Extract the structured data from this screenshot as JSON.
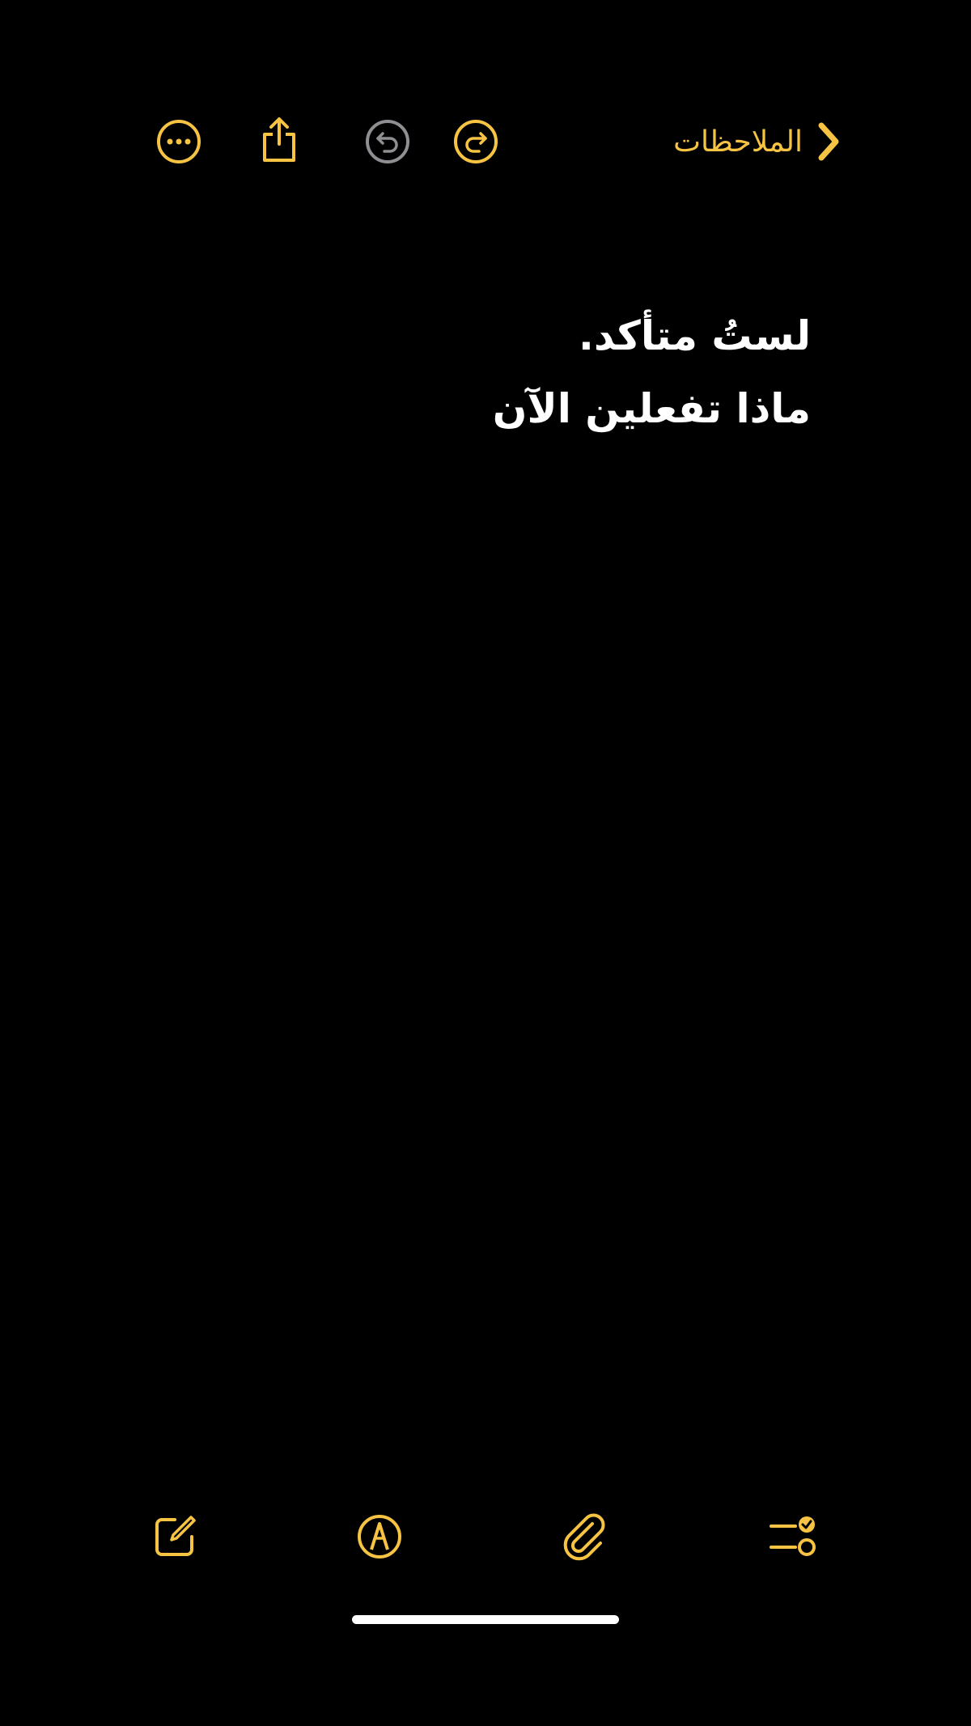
{
  "nav": {
    "back_label": "الملاحظات"
  },
  "note": {
    "lines": [
      "لستُ متأكد.",
      "ماذا تفعلين الآن"
    ]
  },
  "colors": {
    "accent": "#F6C343",
    "disabled": "#8E8E93",
    "background": "#000000",
    "text": "#FFFFFF"
  },
  "icons": {
    "top": [
      "more-icon",
      "share-icon",
      "undo-icon",
      "redo-icon",
      "chevron-right-icon"
    ],
    "bottom": [
      "compose-icon",
      "markup-icon",
      "attachment-icon",
      "checklist-icon"
    ]
  }
}
